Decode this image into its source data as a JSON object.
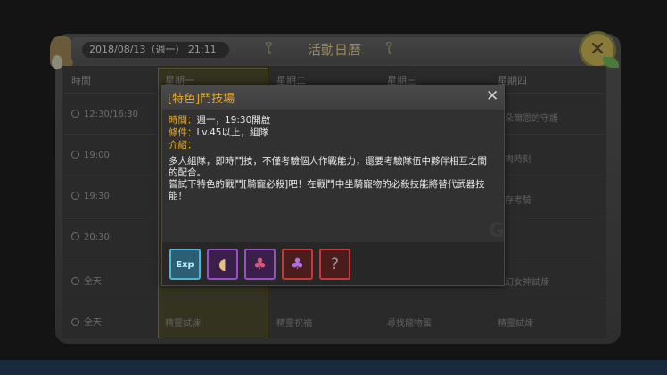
{
  "calendar": {
    "datetime": "2018/08/13（週一） 21:11",
    "title": "活動日曆",
    "columns": [
      "時間",
      "星期一",
      "星期二",
      "星期三",
      "星期四"
    ],
    "times": [
      "12:30/16:30",
      "19:00",
      "19:30",
      "20:30",
      "全天",
      "全天"
    ],
    "events": {
      "thu_row1": "朵爾恩的守護",
      "thu_row2": "肉時刻",
      "thu_row3": "存考驗",
      "thu_row5": "幻女神試煉",
      "mon_row6": "精靈試煉",
      "tue_row6": "精靈祝福",
      "wed_row6": "尋找龍物蛋",
      "thu_row6": "精靈試煉"
    }
  },
  "modal": {
    "title": "[特色]鬥技場",
    "close_icon": "close-icon",
    "time_label": "時間：",
    "time_value": "週一，19:30開啟",
    "cond_label": "條件：",
    "cond_value": "Lv.45以上，組隊",
    "intro_label": "介紹：",
    "desc1": "多人組隊，即時鬥技，不僅考驗個人作戰能力，還要考驗隊伍中夥伴相互之間的配合。",
    "desc2": "嘗試下特色的戰鬥[騎寵必殺]吧！在戰鬥中坐騎寵物的必殺技能將替代武器技能！",
    "rewards": [
      {
        "icon": "exp-icon",
        "label": "Exp",
        "rarity_color": "#4db6d3"
      },
      {
        "icon": "shell-icon",
        "rarity_color": "#9b4fc4"
      },
      {
        "icon": "berry-branch-icon",
        "rarity_color": "#9b4fc4"
      },
      {
        "icon": "grape-icon",
        "rarity_color": "#c43a3a"
      },
      {
        "icon": "mystery-item-icon",
        "rarity_color": "#c43a3a"
      }
    ]
  },
  "colors": {
    "accent": "#e6a825",
    "panel": "#313131"
  }
}
